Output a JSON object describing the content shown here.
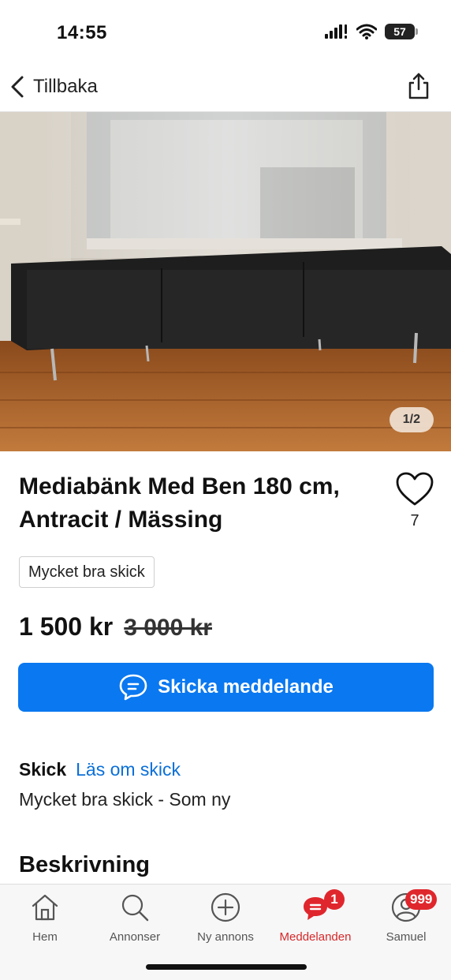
{
  "status_bar": {
    "time": "14:55",
    "battery": "57"
  },
  "nav": {
    "back_label": "Tillbaka",
    "back_icon": "chevron-left-icon",
    "share_icon": "share-icon"
  },
  "photo": {
    "counter": "1/2"
  },
  "listing": {
    "title": "Mediabänk Med Ben 180 cm, Antracit / Mässing",
    "favorites_count": "7",
    "condition_badge": "Mycket bra skick",
    "price": "1 500 kr",
    "original_price": "3 000 kr",
    "message_button": "Skicka meddelande",
    "condition_label": "Skick",
    "condition_link": "Läs om skick",
    "condition_description": "Mycket bra skick - Som ny",
    "description_heading": "Beskrivning"
  },
  "tabs": [
    {
      "label": "Hem",
      "icon": "home-icon"
    },
    {
      "label": "Annonser",
      "icon": "search-icon"
    },
    {
      "label": "Ny annons",
      "icon": "plus-circle-icon"
    },
    {
      "label": "Meddelanden",
      "icon": "chat-icon",
      "badge": "1"
    },
    {
      "label": "Samuel",
      "icon": "profile-icon",
      "badge": "999"
    }
  ],
  "colors": {
    "accent": "#0a78f0",
    "active_tab": "#d7282a",
    "badge": "#e0262d",
    "link": "#0a6fd8"
  }
}
